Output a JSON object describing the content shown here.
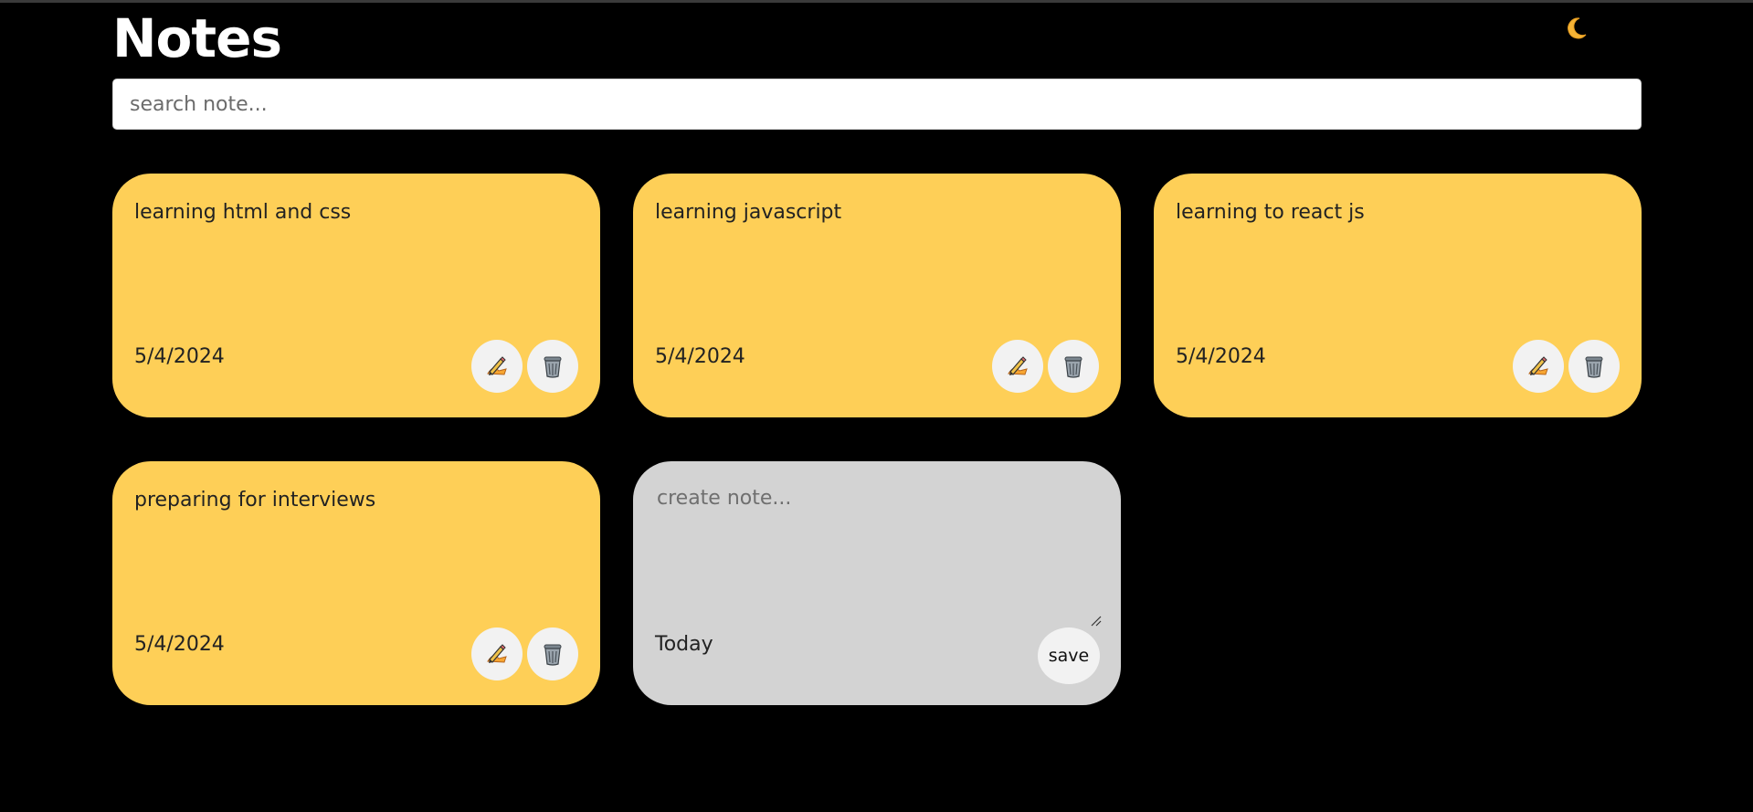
{
  "app": {
    "title": "Notes",
    "theme_toggle_icon": "crescent-moon-icon",
    "accent_color": "#fecf57"
  },
  "search": {
    "placeholder": "search note...",
    "value": ""
  },
  "notes": [
    {
      "text": "learning html and css",
      "date": "5/4/2024"
    },
    {
      "text": "learning javascript",
      "date": "5/4/2024"
    },
    {
      "text": "learning to react js",
      "date": "5/4/2024"
    },
    {
      "text": "preparing for interviews",
      "date": "5/4/2024"
    }
  ],
  "note_actions": {
    "edit_icon": "pencil-writing-icon",
    "delete_icon": "wastebasket-icon"
  },
  "create_note": {
    "placeholder": "create note...",
    "date": "Today",
    "save_label": "save",
    "background_color": "#d3d3d3"
  }
}
